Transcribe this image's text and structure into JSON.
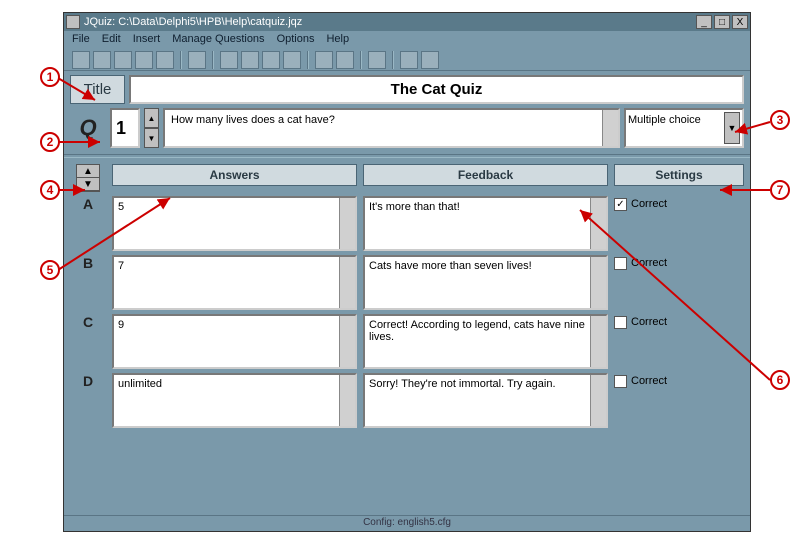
{
  "titlebar": {
    "text": "JQuiz: C:\\Data\\Delphi5\\HPB\\Help\\catquiz.jqz",
    "min": "_",
    "max": "□",
    "close": "X"
  },
  "menu": [
    "File",
    "Edit",
    "Insert",
    "Manage Questions",
    "Options",
    "Help"
  ],
  "labels": {
    "title": "Title",
    "q": "Q",
    "answers": "Answers",
    "feedback": "Feedback",
    "settings": "Settings",
    "correct": "Correct"
  },
  "title_value": "The Cat Quiz",
  "question_number": "1",
  "question_text": "How many lives does a cat have?",
  "question_type": "Multiple choice",
  "rows": [
    {
      "letter": "A",
      "answer": "5",
      "feedback": "It's more than that!",
      "correct": true
    },
    {
      "letter": "B",
      "answer": "7",
      "feedback": "Cats have more than seven lives!",
      "correct": false
    },
    {
      "letter": "C",
      "answer": "9",
      "feedback": "Correct! According to legend, cats have nine lives.",
      "correct": false
    },
    {
      "letter": "D",
      "answer": "unlimited",
      "feedback": "Sorry! They're not immortal. Try again.",
      "correct": false
    }
  ],
  "status": "Config: english5.cfg",
  "callouts": [
    "1",
    "2",
    "3",
    "4",
    "5",
    "6",
    "7"
  ]
}
